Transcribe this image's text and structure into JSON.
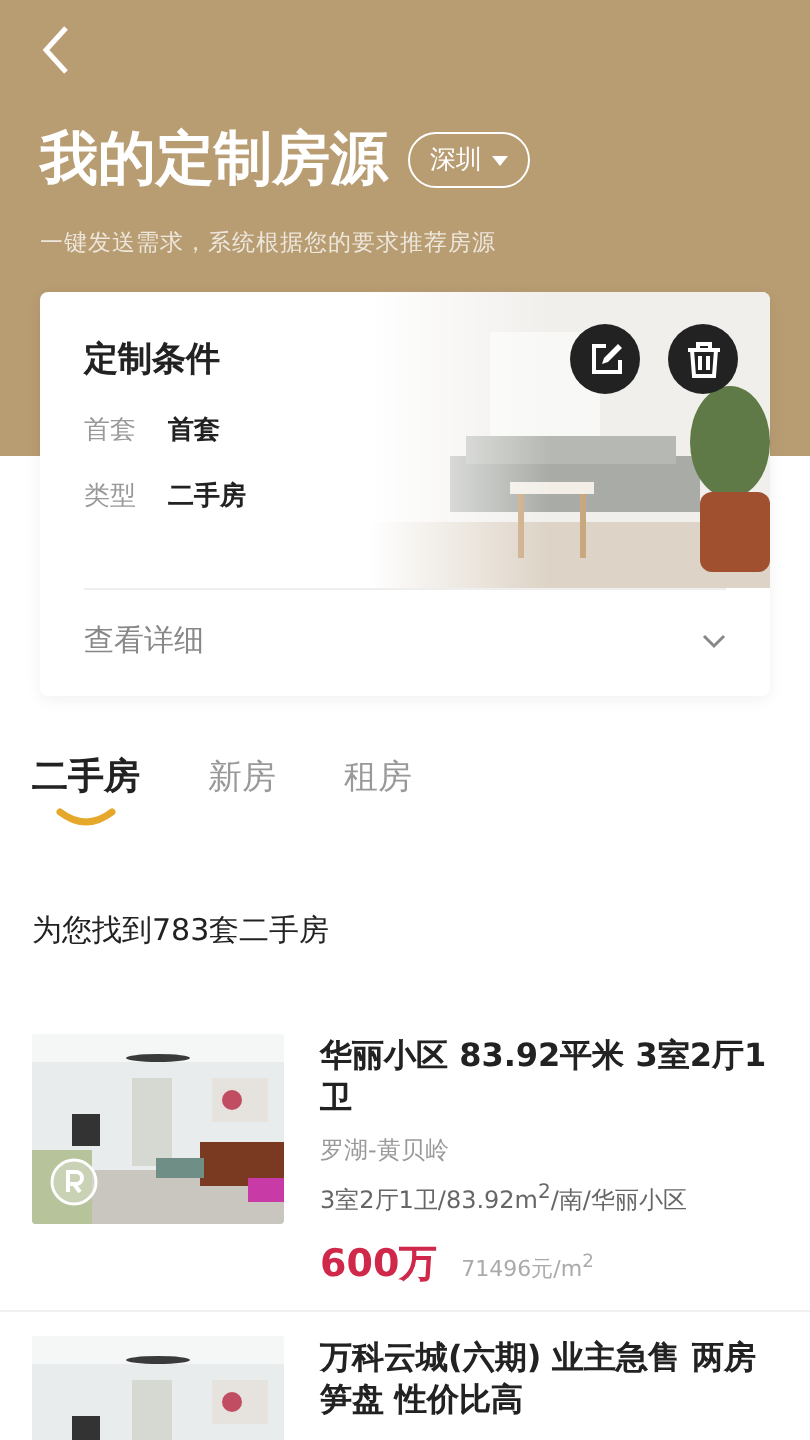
{
  "header": {
    "title": "我的定制房源",
    "city": "深圳",
    "subtitle": "一键发送需求，系统根据您的要求推荐房源"
  },
  "conditions": {
    "title": "定制条件",
    "rows": [
      {
        "label": "首套",
        "value": "首套"
      },
      {
        "label": "类型",
        "value": "二手房"
      }
    ],
    "details_link": "查看详细",
    "expanded": false
  },
  "tabs": [
    {
      "label": "二手房",
      "selected": true
    },
    {
      "label": "新房",
      "selected": false
    },
    {
      "label": "租房",
      "selected": false
    }
  ],
  "result_count": "为您找到783套二手房",
  "listings": [
    {
      "title": "华丽小区 83.92平米 3室2厅1卫",
      "area": "罗湖-黄贝岭",
      "specs": "3室2厅1卫/83.92m$^{2}$/南/华丽小区",
      "price": "600万",
      "unit_price": "71496元/m$^{2}$",
      "vr": true
    },
    {
      "title": "万科云城(六期) 业主急售 两房笋盘 性价比高"
    }
  ]
}
